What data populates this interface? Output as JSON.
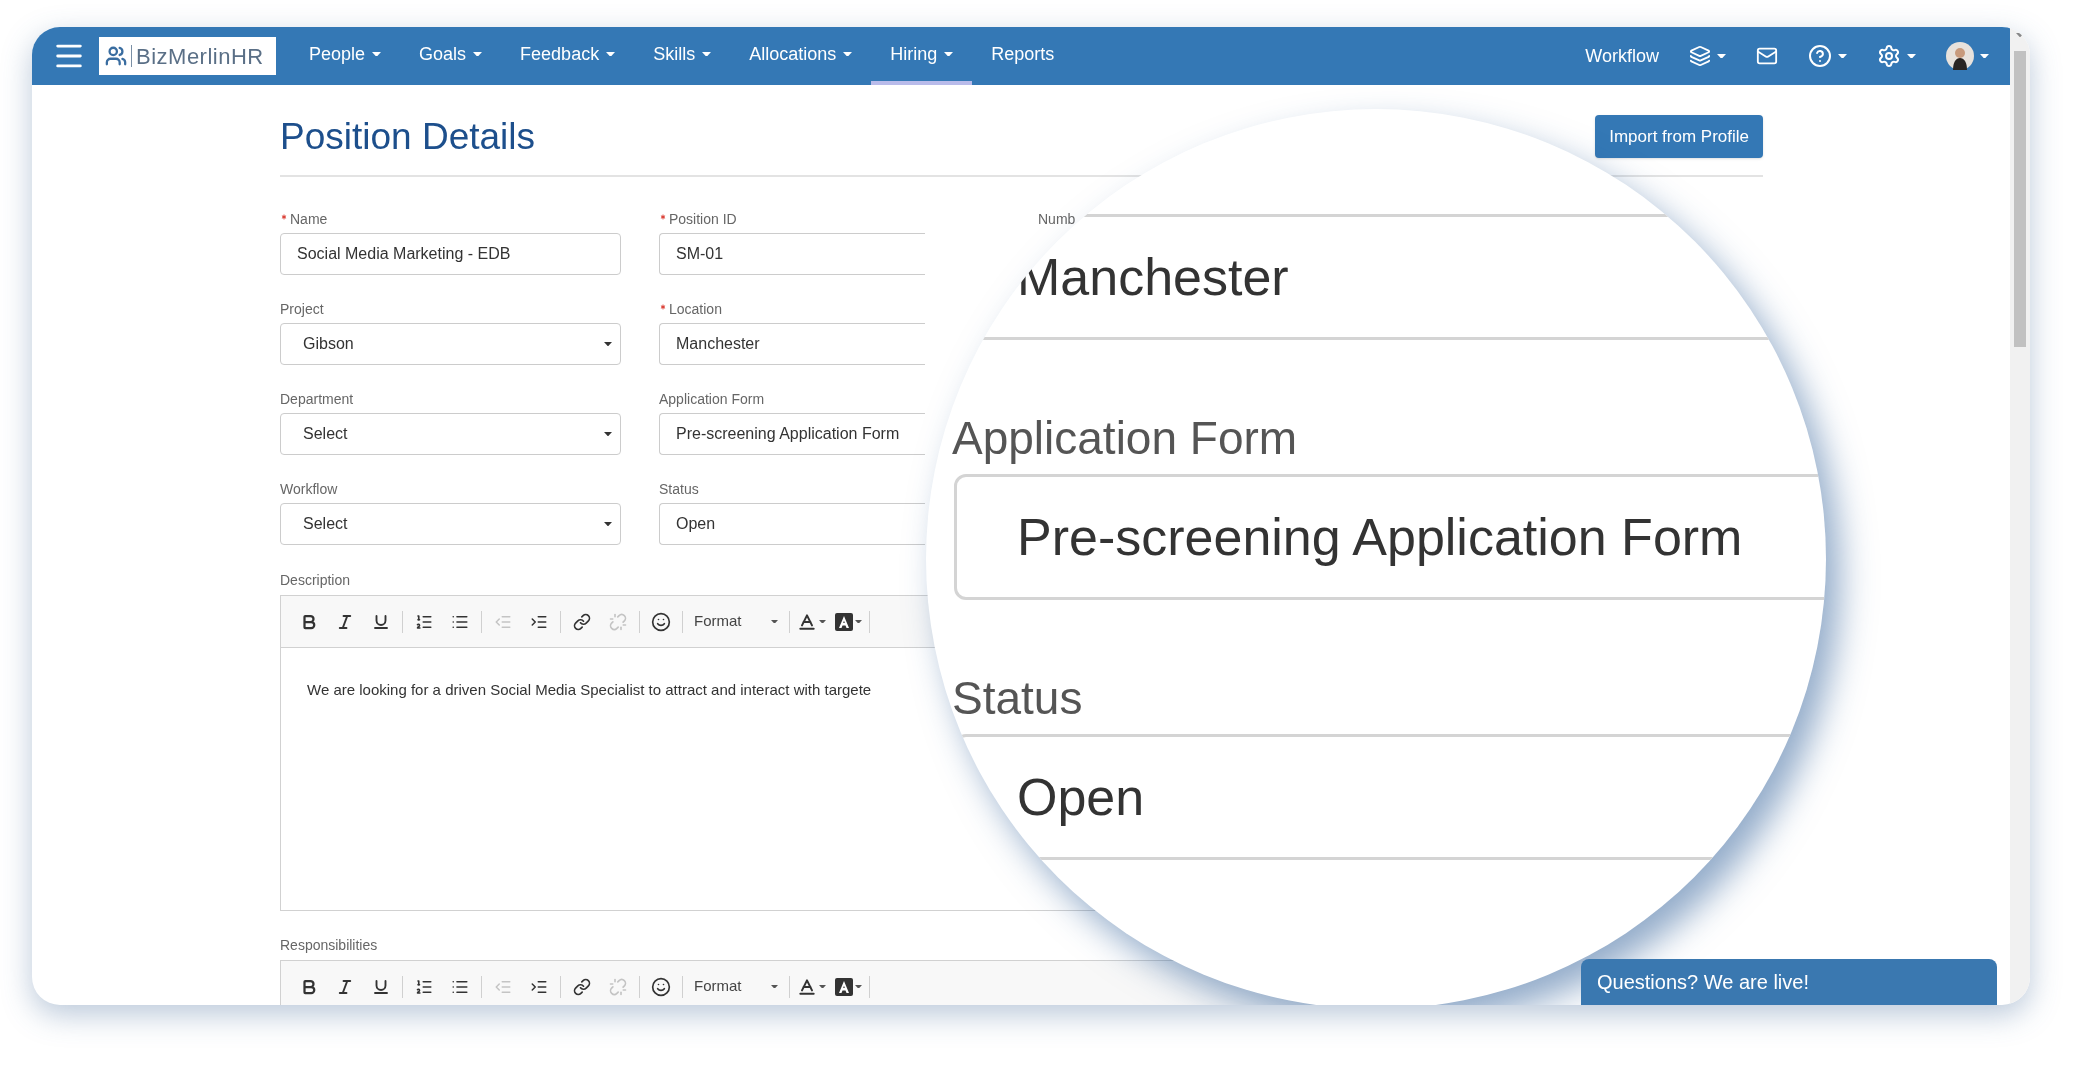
{
  "nav": {
    "logo": "BizMerlinHR",
    "items": [
      {
        "label": "People",
        "has_menu": true,
        "selected": false
      },
      {
        "label": "Goals",
        "has_menu": true,
        "selected": false
      },
      {
        "label": "Feedback",
        "has_menu": true,
        "selected": false
      },
      {
        "label": "Skills",
        "has_menu": true,
        "selected": false
      },
      {
        "label": "Allocations",
        "has_menu": true,
        "selected": false
      },
      {
        "label": "Hiring",
        "has_menu": true,
        "selected": true
      },
      {
        "label": "Reports",
        "has_menu": false,
        "selected": false
      }
    ],
    "right": [
      {
        "kind": "text",
        "label": "Workflow",
        "has_menu": false
      },
      {
        "kind": "layers",
        "has_menu": true
      },
      {
        "kind": "mail",
        "has_menu": false
      },
      {
        "kind": "help",
        "has_menu": true
      },
      {
        "kind": "settings",
        "has_menu": true
      },
      {
        "kind": "avatar",
        "has_menu": true
      }
    ]
  },
  "page": {
    "title": "Position Details",
    "import_button": "Import from Profile"
  },
  "form": {
    "rows": [
      [
        {
          "label": "Name",
          "required": true,
          "kind": "text",
          "value": "Social Media Marketing - EDB"
        },
        {
          "label": "Position ID",
          "required": true,
          "kind": "text",
          "value": "SM-01"
        },
        {
          "label": "Numb",
          "required": false
        }
      ],
      [
        {
          "label": "Project",
          "required": false,
          "kind": "select",
          "value": "Gibson"
        },
        {
          "label": "Location",
          "required": true,
          "kind": "text",
          "value": "Manchester"
        }
      ],
      [
        {
          "label": "Department",
          "required": false,
          "kind": "select",
          "value": "Select"
        },
        {
          "label": "Application Form",
          "required": false,
          "kind": "text",
          "value": "Pre-screening Application Form"
        }
      ],
      [
        {
          "label": "Workflow",
          "required": false,
          "kind": "select",
          "value": "Select"
        },
        {
          "label": "Status",
          "required": false,
          "kind": "text",
          "value": "Open"
        }
      ]
    ]
  },
  "editors": [
    {
      "label": "Description",
      "text": "We are looking for a driven Social Media Specialist to attract and interact with targete",
      "tools": [
        {
          "kind": "bold",
          "disabled": false
        },
        {
          "kind": "italic",
          "disabled": false
        },
        {
          "kind": "underline",
          "disabled": false
        },
        {
          "kind": "separator"
        },
        {
          "kind": "ordered_list",
          "disabled": false
        },
        {
          "kind": "bullet_list",
          "disabled": false
        },
        {
          "kind": "separator"
        },
        {
          "kind": "outdent",
          "disabled": true
        },
        {
          "kind": "indent",
          "disabled": false
        },
        {
          "kind": "separator"
        },
        {
          "kind": "link",
          "disabled": false
        },
        {
          "kind": "unlink",
          "disabled": true
        },
        {
          "kind": "separator"
        },
        {
          "kind": "emoji",
          "disabled": false
        },
        {
          "kind": "separator"
        },
        {
          "kind": "format",
          "label": "Format",
          "disabled": false
        },
        {
          "kind": "separator"
        },
        {
          "kind": "text_color",
          "disabled": false
        },
        {
          "kind": "bg_color",
          "disabled": false
        },
        {
          "kind": "separator"
        }
      ]
    },
    {
      "label": "Responsibilities",
      "tools": [
        {
          "kind": "bold",
          "disabled": false
        },
        {
          "kind": "italic",
          "disabled": false
        },
        {
          "kind": "underline",
          "disabled": false
        },
        {
          "kind": "separator"
        },
        {
          "kind": "ordered_list",
          "disabled": false
        },
        {
          "kind": "bullet_list",
          "disabled": false
        },
        {
          "kind": "separator"
        },
        {
          "kind": "outdent",
          "disabled": true
        },
        {
          "kind": "indent",
          "disabled": false
        },
        {
          "kind": "separator"
        },
        {
          "kind": "link",
          "disabled": false
        },
        {
          "kind": "unlink",
          "disabled": true
        },
        {
          "kind": "separator"
        },
        {
          "kind": "emoji",
          "disabled": false
        },
        {
          "kind": "separator"
        },
        {
          "kind": "format",
          "label": "Format",
          "disabled": false
        },
        {
          "kind": "separator"
        },
        {
          "kind": "text_color",
          "disabled": false
        },
        {
          "kind": "bg_color",
          "disabled": false
        },
        {
          "kind": "separator"
        }
      ]
    }
  ],
  "chat": {
    "label": "Questions? We are live!"
  },
  "magnifier": {
    "fields": [
      {
        "value": "Manchester"
      },
      {
        "label": "Application Form",
        "value": "Pre-screening Application Form"
      },
      {
        "label": "Status",
        "value": "Open"
      }
    ]
  }
}
